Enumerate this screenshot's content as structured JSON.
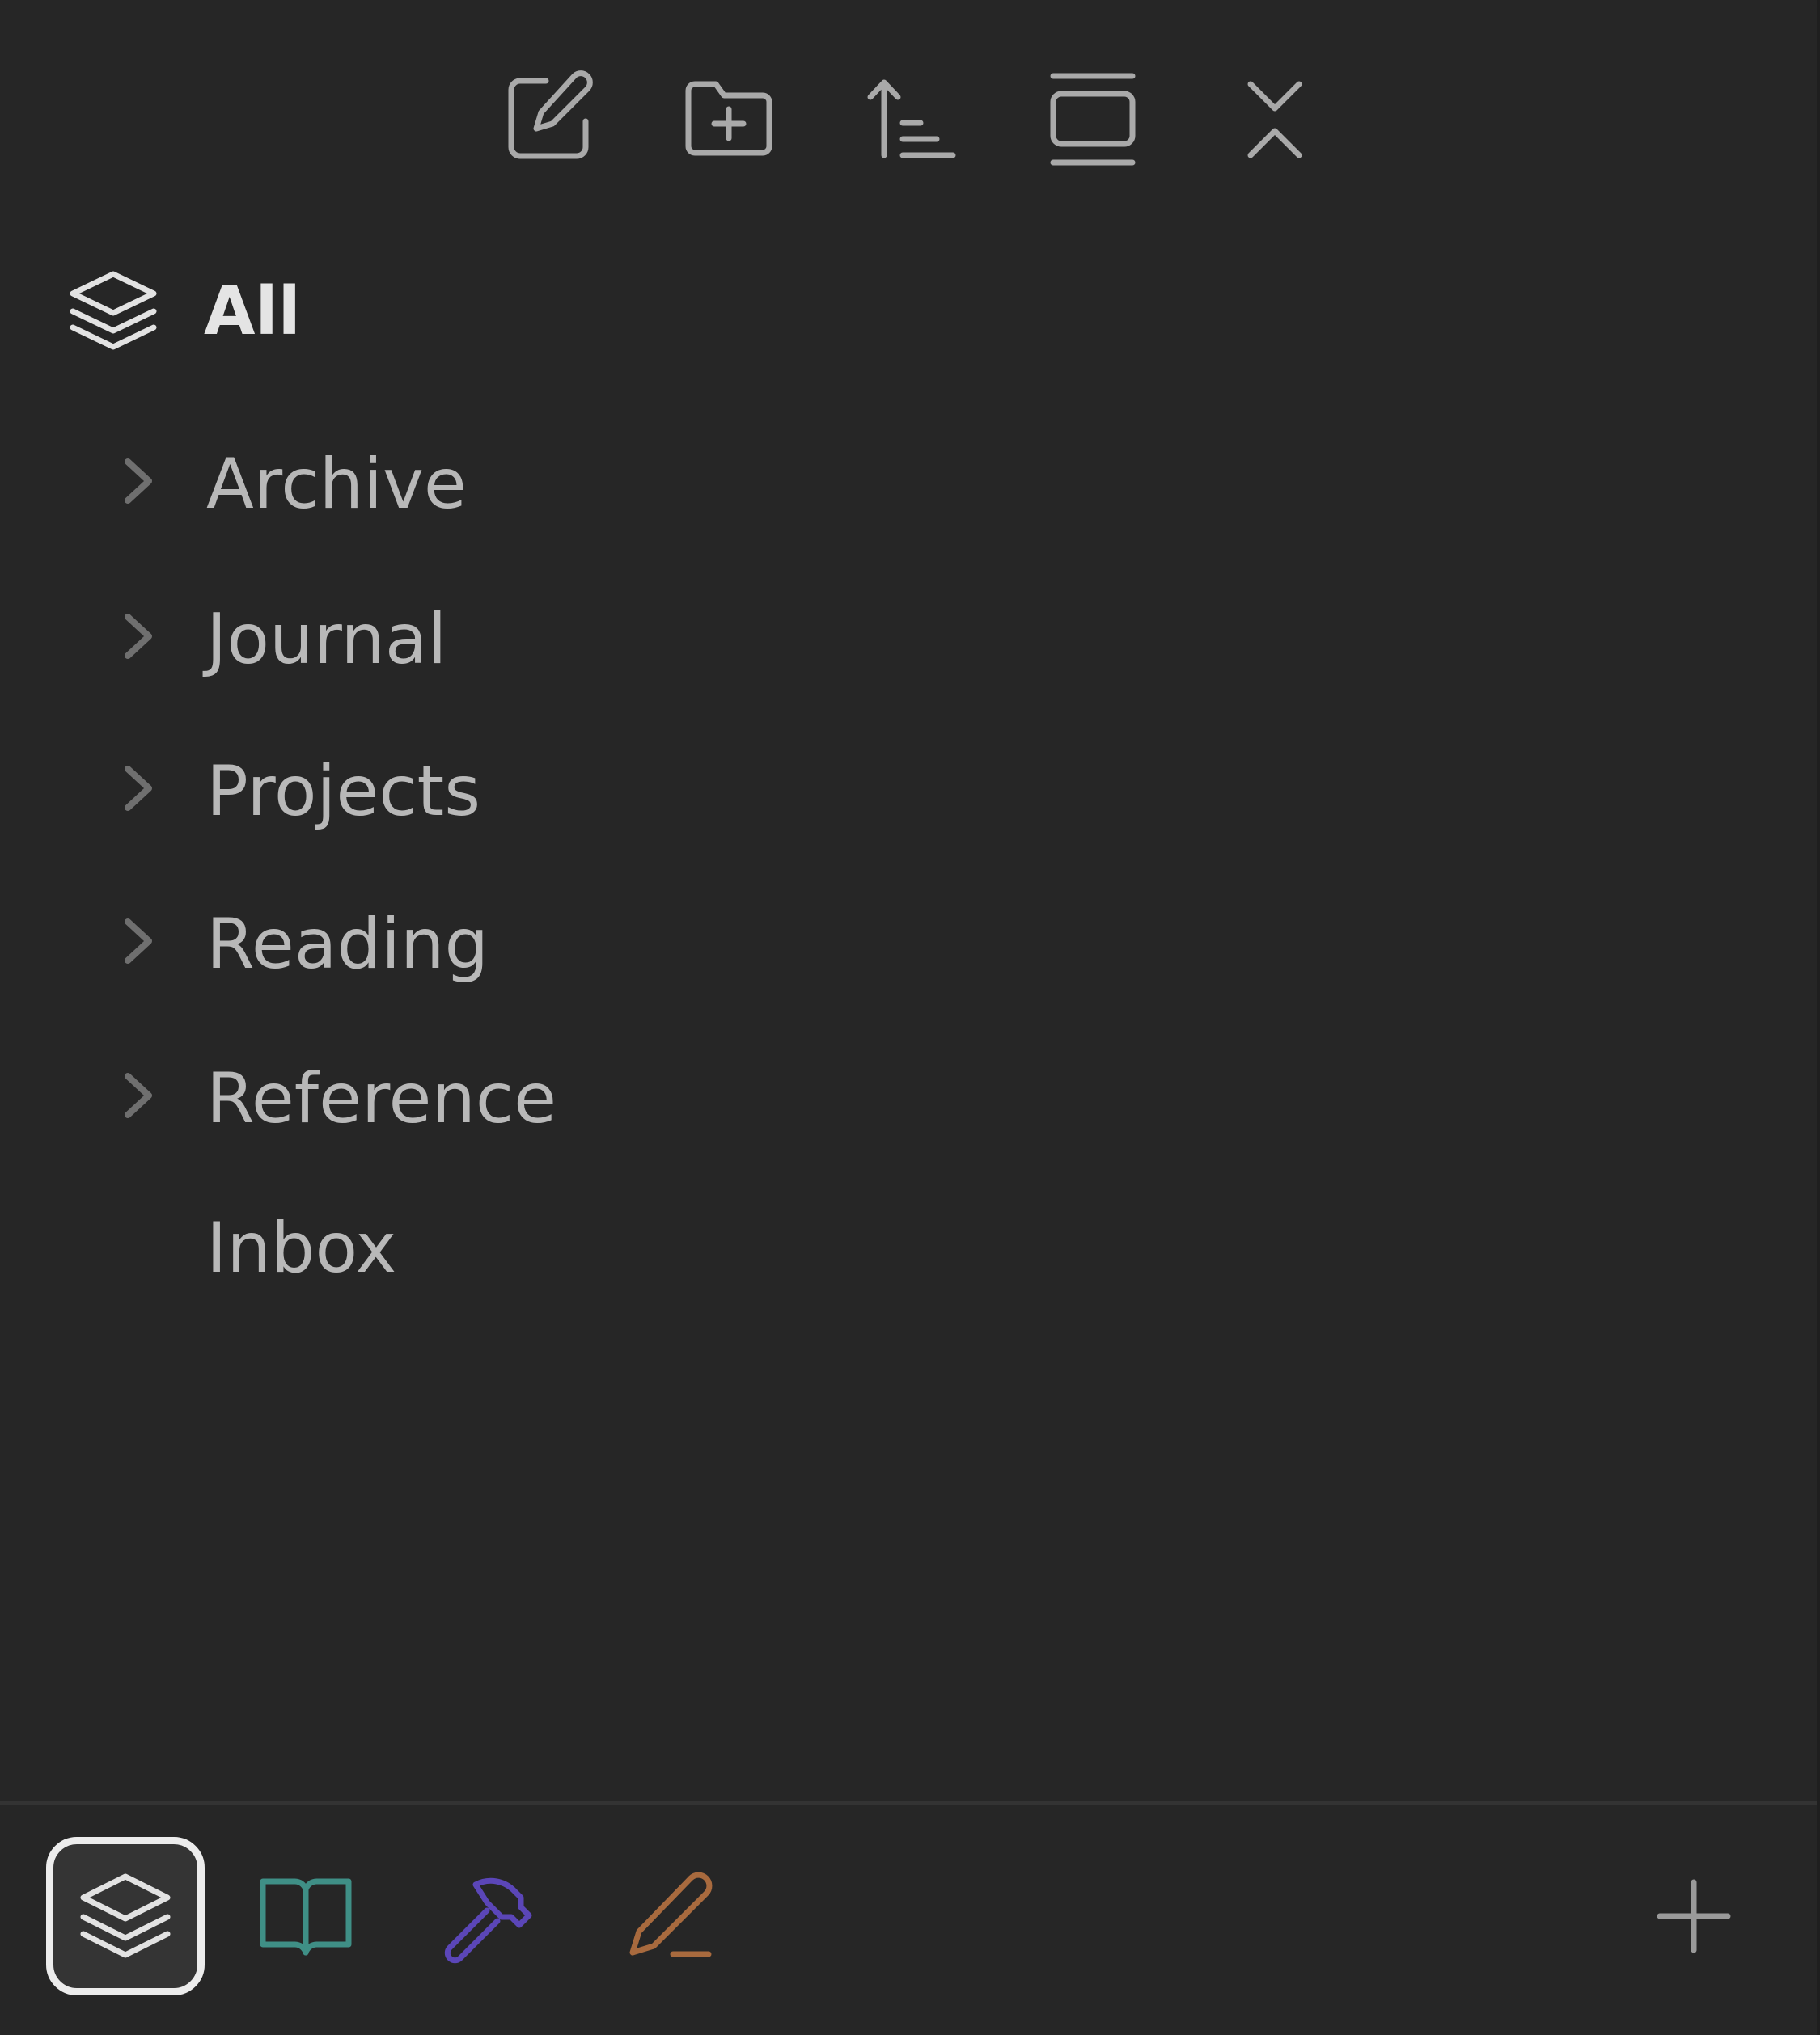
{
  "toolbar": {
    "buttons": [
      {
        "name": "new-note",
        "icon": "pencil-square-icon"
      },
      {
        "name": "new-folder",
        "icon": "folder-plus-icon"
      },
      {
        "name": "sort",
        "icon": "sort-ascending-icon"
      },
      {
        "name": "auto-reveal",
        "icon": "view-rectangle-icon"
      },
      {
        "name": "collapse-all",
        "icon": "chevrons-collapse-icon"
      }
    ]
  },
  "tree": {
    "header": {
      "label": "All",
      "icon": "layers-icon"
    },
    "items": [
      {
        "label": "Archive",
        "expandable": true
      },
      {
        "label": "Journal",
        "expandable": true
      },
      {
        "label": "Projects",
        "expandable": true
      },
      {
        "label": "Reading",
        "expandable": true
      },
      {
        "label": "Reference",
        "expandable": true
      },
      {
        "label": "Inbox",
        "expandable": false
      }
    ]
  },
  "bottom_bar": {
    "tabs": [
      {
        "icon": "layers-icon",
        "color": "#e2e2e2",
        "active": true
      },
      {
        "icon": "open-book-icon",
        "color": "#3f8f86",
        "active": false
      },
      {
        "icon": "hammer-icon",
        "color": "#5b46b8",
        "active": false
      },
      {
        "icon": "pencil-line-icon",
        "color": "#a86a3e",
        "active": false
      }
    ],
    "add_icon": "plus-icon"
  }
}
